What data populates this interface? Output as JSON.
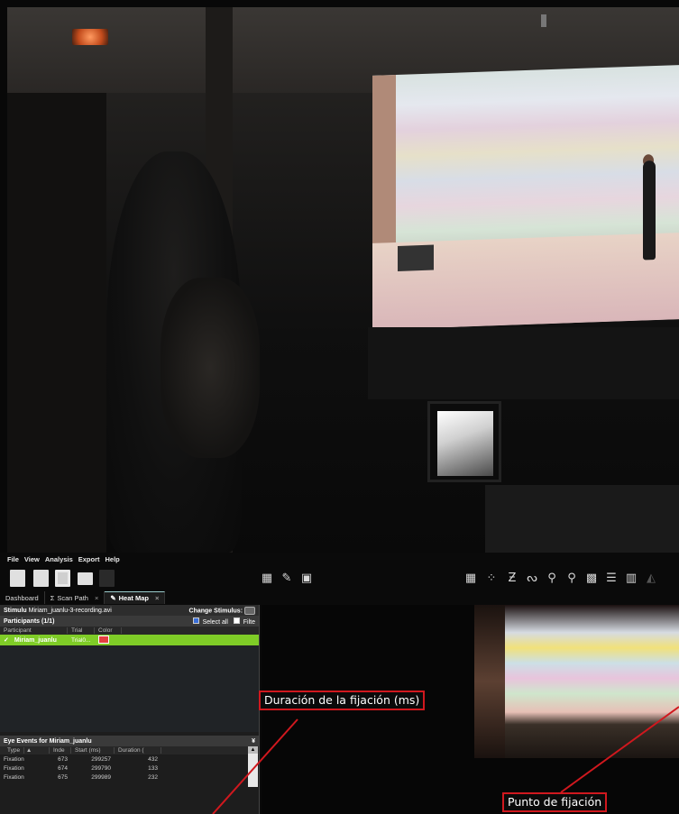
{
  "menu": [
    "File",
    "View",
    "Analysis",
    "Export",
    "Help"
  ],
  "tabs": [
    {
      "label": "Dashboard",
      "icon": "",
      "close": ""
    },
    {
      "label": "Scan Path",
      "icon": "Σ",
      "close": "×"
    },
    {
      "label": "Heat Map",
      "icon": "✎",
      "close": "×"
    }
  ],
  "stimulus": {
    "label": "Stimulu",
    "value": "Miriam_juanlu-3-recording.avi",
    "change_label": "Change Stimulus:"
  },
  "participants": {
    "header": "Participants (1/1)",
    "select_all": "Select all",
    "filter": "Filte",
    "columns": [
      "Participant",
      "Trial",
      "Color"
    ],
    "rows": [
      {
        "name": "Miriam_juanlu",
        "trial": "Trial0...",
        "color": "#e44040"
      }
    ]
  },
  "eye_events": {
    "header": "Eye Events for Miriam_juanlu",
    "columns": [
      "Type",
      "Inde",
      "Start (ms)",
      "Duration ("
    ],
    "rows": [
      {
        "type": "Fixation",
        "index": "673",
        "start": "299257",
        "duration": "432"
      },
      {
        "type": "Fixation",
        "index": "674",
        "start": "299790",
        "duration": "133"
      },
      {
        "type": "Fixation",
        "index": "675",
        "start": "299989",
        "duration": "232"
      }
    ]
  },
  "annotations": {
    "duration": "Duración de la fijación (ms)",
    "fixation_point": "Punto de fijación"
  },
  "colors": {
    "annotation_border": "#d0181e",
    "participant_highlight": "#7fcc27"
  }
}
